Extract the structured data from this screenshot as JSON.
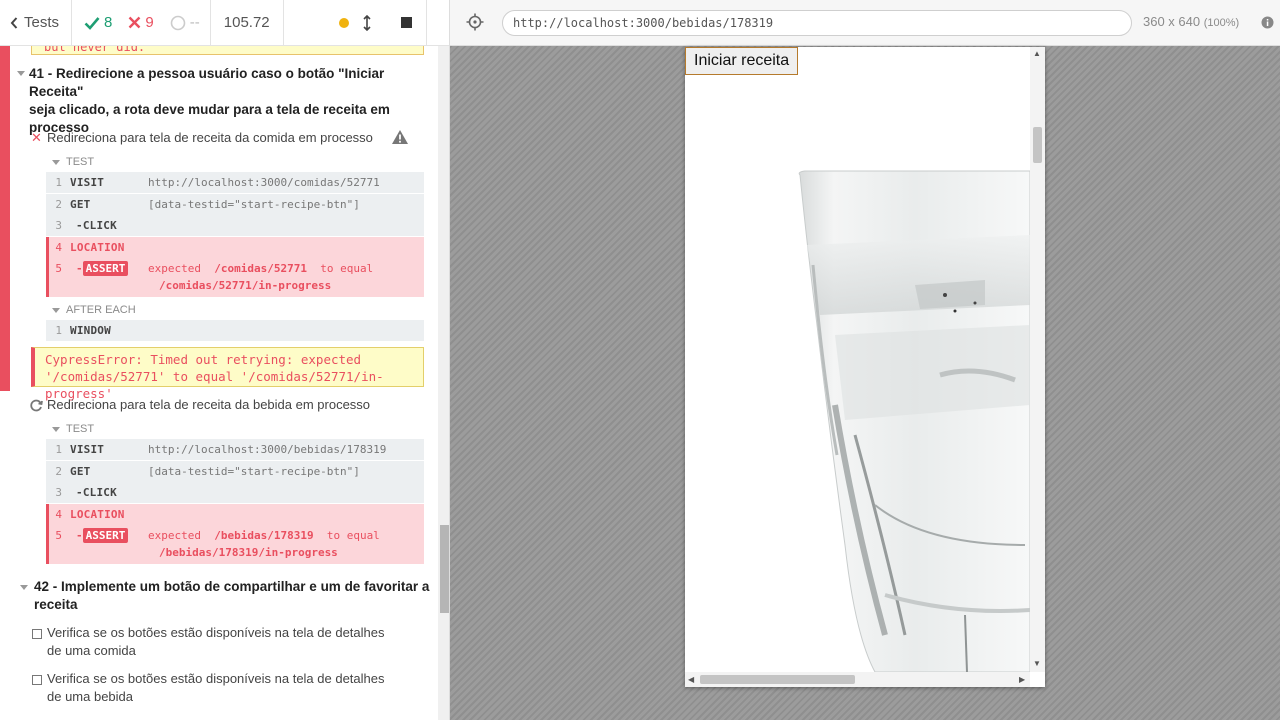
{
  "header": {
    "tests_label": "Tests",
    "passed_count": "8",
    "failed_count": "9",
    "pending_count": "--",
    "duration": "105.72"
  },
  "aut": {
    "url": "http://localhost:3000/bebidas/178319",
    "viewport": "360 x 640",
    "scale": "(100%)",
    "start_button_label": "Iniciar receita"
  },
  "prev_error_fragment": "but never did.",
  "suite41": {
    "title": "41 - Redirecione a pessoa usuário caso o botão \"Iniciar Receita\" seja clicado, a rota deve mudar para a tela de receita em processo",
    "title_lines": [
      "41 - Redirecione a pessoa usuário caso o botão \"Iniciar Receita\"",
      "seja clicado, a rota deve mudar para a tela de receita em",
      "processo"
    ],
    "test1": {
      "title": "Redireciona para tela de receita da comida em processo",
      "section_test": "TEST",
      "section_after": "AFTER EACH",
      "commands": [
        {
          "n": "1",
          "name": "VISIT",
          "msg": "http://localhost:3000/comidas/52771"
        },
        {
          "n": "2",
          "name": "GET",
          "msg": "[data-testid=\"start-recipe-btn\"]"
        },
        {
          "n": "3",
          "name": "-CLICK",
          "msg": ""
        },
        {
          "n": "4",
          "name": "LOCATION",
          "msg": ""
        },
        {
          "n": "5",
          "name": "ASSERT",
          "msg_pre": "expected",
          "msg_val": "/comidas/52771",
          "msg_mid": "to equal",
          "msg_val2": "/comidas/52771/in-progress"
        }
      ],
      "after": [
        {
          "n": "1",
          "name": "WINDOW"
        }
      ],
      "error_lines": [
        "CypressError: Timed out retrying: expected",
        "'/comidas/52771' to equal '/comidas/52771/in-progress'"
      ]
    },
    "test2": {
      "title": "Redireciona para tela de receita da bebida em processo",
      "section_test": "TEST",
      "commands": [
        {
          "n": "1",
          "name": "VISIT",
          "msg": "http://localhost:3000/bebidas/178319"
        },
        {
          "n": "2",
          "name": "GET",
          "msg": "[data-testid=\"start-recipe-btn\"]"
        },
        {
          "n": "3",
          "name": "-CLICK",
          "msg": ""
        },
        {
          "n": "4",
          "name": "LOCATION",
          "msg": ""
        },
        {
          "n": "5",
          "name": "ASSERT",
          "msg_pre": "expected",
          "msg_val": "/bebidas/178319",
          "msg_mid": "to equal",
          "msg_val2": "/bebidas/178319/in-progress"
        }
      ]
    }
  },
  "suite42": {
    "title_lines": [
      "42 - Implemente um botão de compartilhar e um de favoritar a",
      "receita"
    ],
    "tests": [
      {
        "lines": [
          "Verifica se os botões estão disponíveis na tela de detalhes",
          "de uma comida"
        ]
      },
      {
        "lines": [
          "Verifica se os botões estão disponíveis na tela de detalhes",
          "de uma bebida"
        ]
      }
    ]
  },
  "colors": {
    "pass": "#1e9e73",
    "fail": "#e94f5f",
    "pending_dot": "#f0b20e"
  }
}
